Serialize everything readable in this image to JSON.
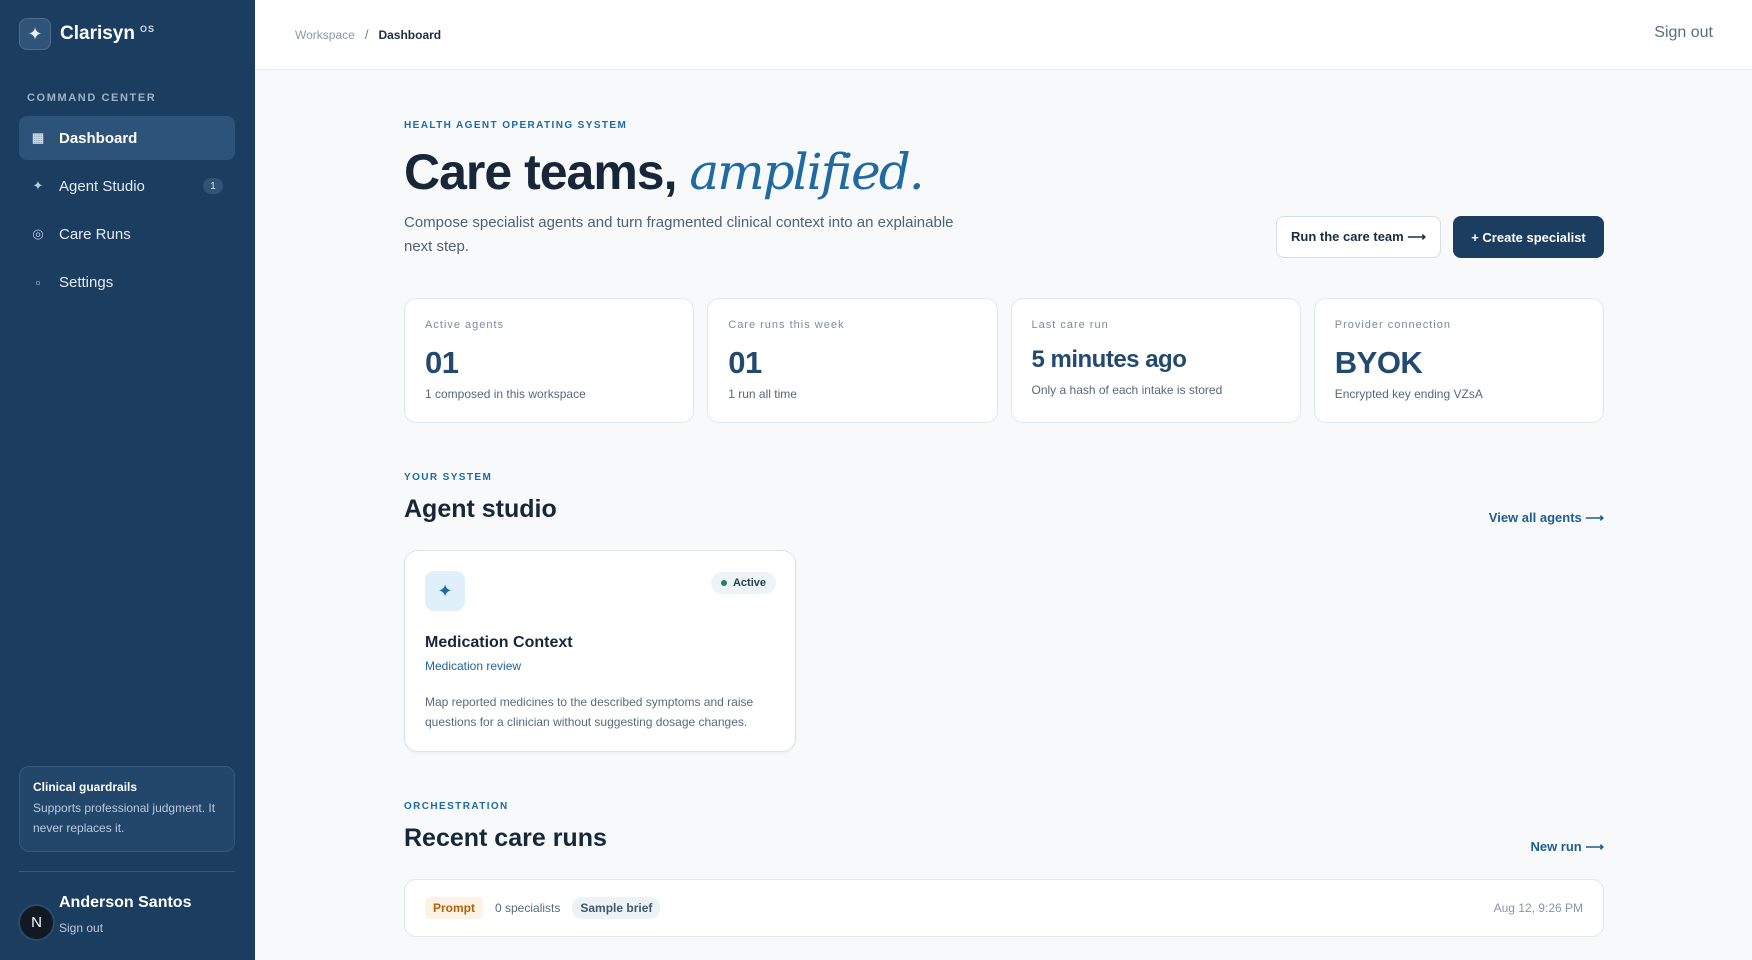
{
  "brand": {
    "name": "Clarisyn",
    "suffix": "OS",
    "mark": "✦"
  },
  "sidebar": {
    "section_label": "COMMAND CENTER",
    "items": [
      {
        "label": "Dashboard",
        "icon": "grid-icon",
        "glyph": "▦",
        "active": true,
        "badge": ""
      },
      {
        "label": "Agent Studio",
        "icon": "sparkle-icon",
        "glyph": "✦",
        "active": false,
        "badge": "1"
      },
      {
        "label": "Care Runs",
        "icon": "ring-icon",
        "glyph": "◎",
        "active": false,
        "badge": ""
      },
      {
        "label": "Settings",
        "icon": "square-icon",
        "glyph": "▫",
        "active": false,
        "badge": ""
      }
    ],
    "guardrails": {
      "title": "Clinical guardrails",
      "text": "Supports professional judgment. It never replaces it."
    },
    "user": {
      "initial": "N",
      "name": "Anderson Santos",
      "signout": "Sign out"
    }
  },
  "topbar": {
    "breadcrumb": {
      "parent": "Workspace",
      "separator": "/",
      "current": "Dashboard"
    },
    "signout": "Sign out"
  },
  "hero": {
    "eyebrow": "HEALTH AGENT OPERATING SYSTEM",
    "title_main": "Care teams,",
    "title_accent": "amplified.",
    "description": "Compose specialist agents and turn fragmented clinical context into an explainable next step.",
    "run_button": "Run the care team ⟶",
    "create_button": "+ Create specialist"
  },
  "stats": [
    {
      "label": "Active agents",
      "value": "01",
      "sub": "1 composed in this workspace"
    },
    {
      "label": "Care runs this week",
      "value": "01",
      "sub": "1 run all time"
    },
    {
      "label": "Last care run",
      "value": "5 minutes ago",
      "sub": "Only a hash of each intake is stored"
    },
    {
      "label": "Provider connection",
      "value": "BYOK",
      "sub": "Encrypted key ending VZsA"
    }
  ],
  "studio": {
    "eyebrow": "YOUR SYSTEM",
    "title": "Agent studio",
    "link": "View all agents ⟶",
    "agent": {
      "icon": "✦",
      "status": "Active",
      "name": "Medication Context",
      "role": "Medication review",
      "description": "Map reported medicines to the described symptoms and raise questions for a clinician without suggesting dosage changes."
    }
  },
  "runs": {
    "eyebrow": "ORCHESTRATION",
    "title": "Recent care runs",
    "link": "New run ⟶",
    "items": [
      {
        "type": "Prompt",
        "specialists": "0 specialists",
        "source": "Sample brief",
        "time": "Aug 12, 9:26 PM"
      }
    ]
  },
  "colors": {
    "sidebar": "#1b3d5f",
    "accent": "#1f6aa0",
    "primary_button": "#1b3d5f",
    "prompt_tag": "#b0620b",
    "active_dot": "#238060"
  }
}
